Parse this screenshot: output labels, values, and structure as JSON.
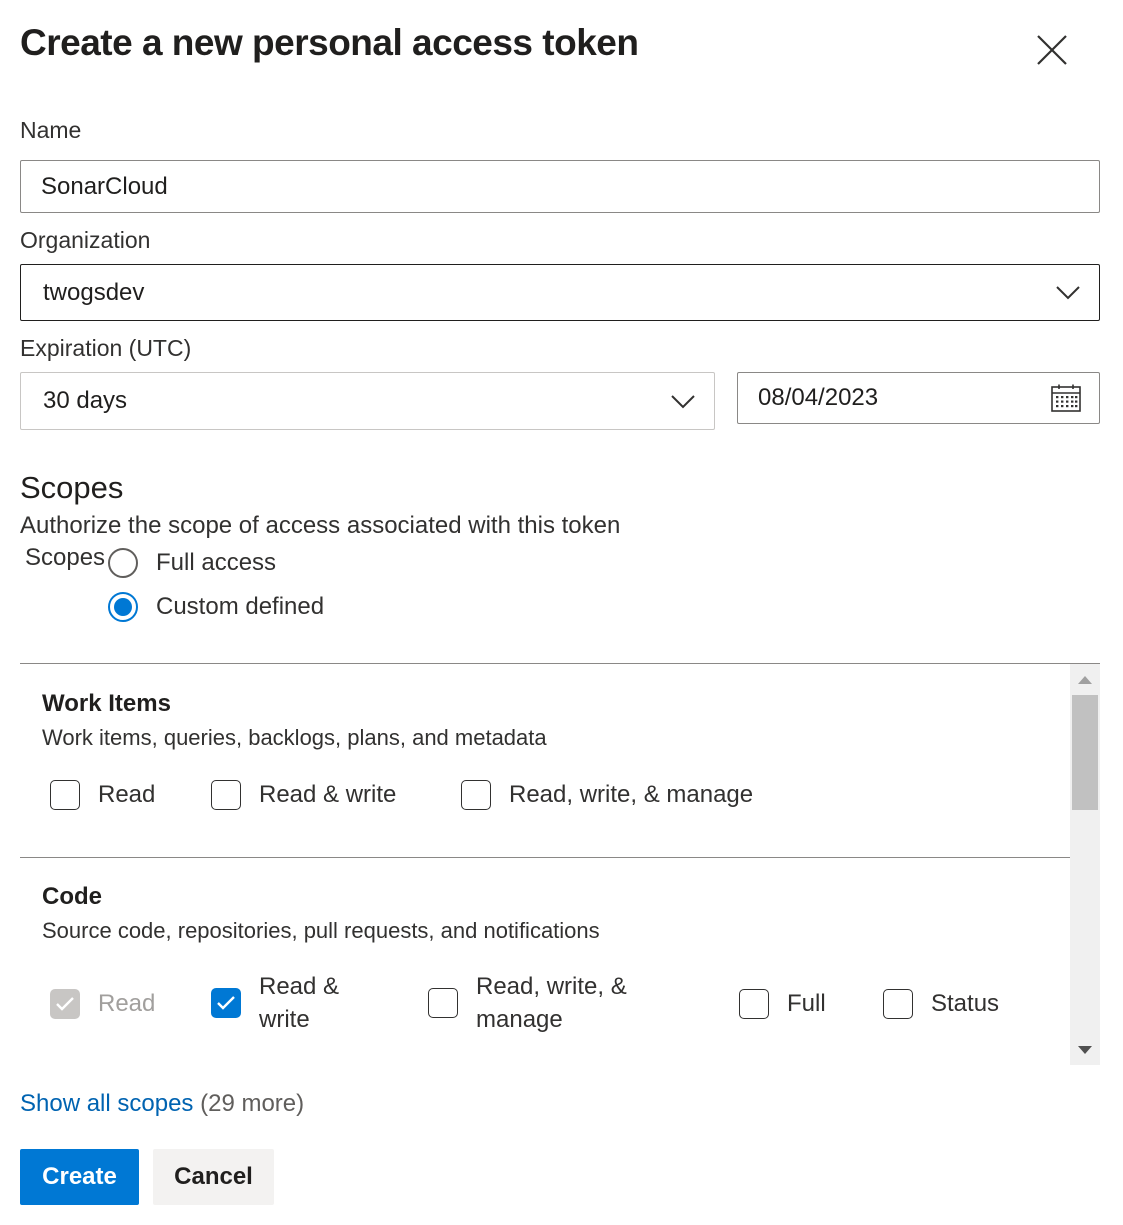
{
  "dialog": {
    "title": "Create a new personal access token",
    "close_icon": "close-icon"
  },
  "form": {
    "name_label": "Name",
    "name_value": "SonarCloud",
    "org_label": "Organization",
    "org_value": "twogsdev",
    "expiration_label": "Expiration (UTC)",
    "expiration_value": "30 days",
    "expiration_date": "08/04/2023"
  },
  "scopes": {
    "heading": "Scopes",
    "description": "Authorize the scope of access associated with this token",
    "field_label": "Scopes",
    "options": [
      {
        "label": "Full access",
        "selected": false
      },
      {
        "label": "Custom defined",
        "selected": true
      }
    ],
    "groups": [
      {
        "title": "Work Items",
        "description": "Work items, queries, backlogs, plans, and metadata",
        "checkboxes": [
          {
            "label": "Read",
            "checked": false,
            "disabled": false
          },
          {
            "label": "Read & write",
            "checked": false,
            "disabled": false
          },
          {
            "label": "Read, write, & manage",
            "checked": false,
            "disabled": false
          }
        ]
      },
      {
        "title": "Code",
        "description": "Source code, repositories, pull requests, and notifications",
        "checkboxes": [
          {
            "label": "Read",
            "checked": true,
            "disabled": true
          },
          {
            "label_line1": "Read &",
            "label_line2": "write",
            "checked": true,
            "disabled": false
          },
          {
            "label_line1": "Read, write, &",
            "label_line2": "manage",
            "checked": false,
            "disabled": false
          },
          {
            "label": "Full",
            "checked": false,
            "disabled": false
          },
          {
            "label": "Status",
            "checked": false,
            "disabled": false
          }
        ]
      }
    ],
    "show_all_link": "Show all scopes",
    "show_all_count": "(29 more)"
  },
  "actions": {
    "create_label": "Create",
    "cancel_label": "Cancel"
  },
  "colors": {
    "accent": "#0078d4",
    "link": "#0063b1",
    "text": "#201f1e"
  }
}
